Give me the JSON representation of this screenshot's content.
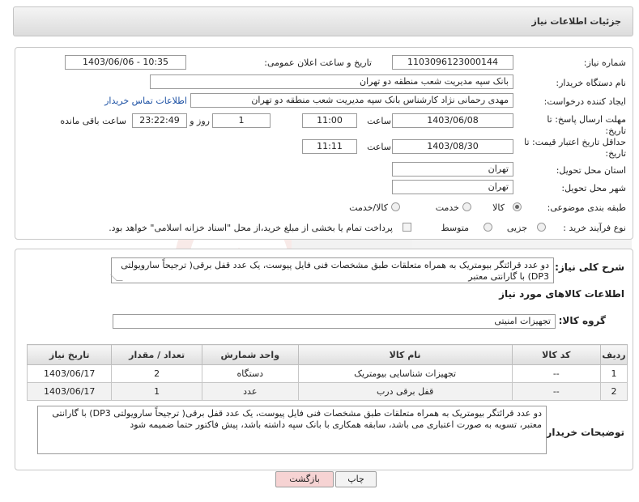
{
  "header": {
    "title": "جزئیات اطلاعات نیاز"
  },
  "form": {
    "need_number_label": "شماره نیاز:",
    "need_number": "1103096123000144",
    "announce_label": "تاریخ و ساعت اعلان عمومی:",
    "announce_value": "1403/06/06 - 10:35",
    "buyer_org_label": "نام دستگاه خریدار:",
    "buyer_org": "بانک سپه مدیریت شعب منطقه دو تهران",
    "requester_label": "ایجاد کننده درخواست:",
    "requester": "مهدی رحمانی نژاد کارشناس بانک سپه مدیریت شعب منطقه دو تهران",
    "contact_link": "اطلاعات تماس خریدار",
    "send_deadline_label": "مهلت ارسال پاسخ: تا تاریخ:",
    "send_deadline_date": "1403/06/08",
    "time_label": "ساعت",
    "send_deadline_time": "11:00",
    "days_value": "1",
    "days_label": "روز و",
    "remaining_time": "23:22:49",
    "remaining_label": "ساعت باقی مانده",
    "price_validity_label": "حداقل تاریخ اعتبار قیمت: تا تاریخ:",
    "price_validity_date": "1403/08/30",
    "price_validity_time": "11:11",
    "province_label": "استان محل تحویل:",
    "province": "تهران",
    "city_label": "شهر محل تحویل:",
    "city": "تهران",
    "category_label": "طبقه بندی موضوعی:",
    "category_options": [
      "کالا",
      "خدمت",
      "کالا/خدمت"
    ],
    "category_selected": "کالا",
    "process_label": "نوع فرآیند خرید :",
    "process_options": [
      "جزیی",
      "متوسط"
    ],
    "payment_note": "پرداخت تمام یا بخشی از مبلغ خرید،از محل \"اسناد خزانه اسلامی\" خواهد بود."
  },
  "description": {
    "label": "شرح کلی نیاز:",
    "text": "دو عدد قرائتگر بیومتریک به همراه متعلقات طبق  مشخصات فنی فایل پیوست، یک عدد قفل برقی( ترجیحاً سارویولتی DP3) با گارانتی معتبر"
  },
  "goods_info": {
    "title": "اطلاعات کالاهای مورد نیاز",
    "group_label": "گروه کالا:",
    "group_value": "تجهیزات امنیتی"
  },
  "table": {
    "headers": [
      "ردیف",
      "کد کالا",
      "نام کالا",
      "واحد شمارش",
      "تعداد / مقدار",
      "تاریخ نیاز"
    ],
    "rows": [
      [
        "1",
        "--",
        "تجهیزات شناسایی بیومتریک",
        "دستگاه",
        "2",
        "1403/06/17"
      ],
      [
        "2",
        "--",
        "قفل برقی درب",
        "عدد",
        "1",
        "1403/06/17"
      ]
    ]
  },
  "buyer_notes": {
    "label": "توضیحات خریدار:",
    "text": "دو عدد قرائتگر بیومتریک به همراه متعلقات طبق  مشخصات فنی فایل پیوست، یک عدد قفل برقی( ترجیحاً سارویولتی DP3) با گارانتی معتبر، تسویه به صورت اعتباری می باشد، سابقه همکاری با بانک سپه داشته باشد، پیش فاکتور حتما ضمیمه شود"
  },
  "buttons": {
    "print": "چاپ",
    "back": "بازگشت"
  },
  "colors": {
    "back_button_bg": "#f6d3d3",
    "print_button_bg": "#f3f3f3",
    "link": "#1a4fa3",
    "watermark": "#c0392b"
  }
}
